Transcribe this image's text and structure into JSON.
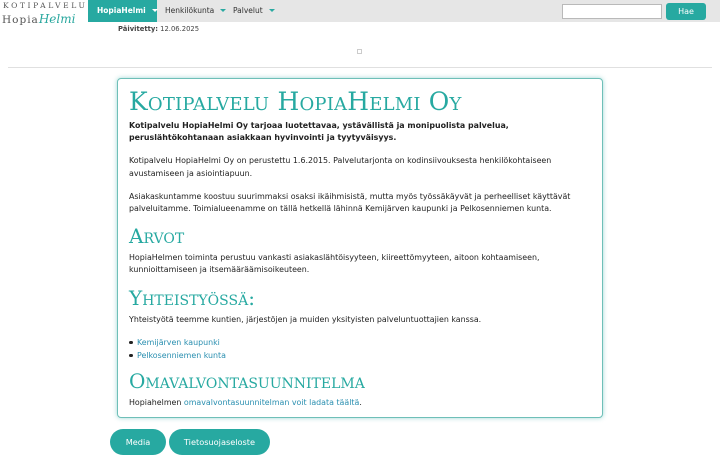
{
  "logo": {
    "top_text": "KOTIPALVELU",
    "hopia": "Hopia",
    "helmi": "Helmi"
  },
  "nav": {
    "items": [
      {
        "label": "HopiaHelmi",
        "active": true
      },
      {
        "label": "Henkilökunta",
        "active": false
      },
      {
        "label": "Palvelut",
        "active": false
      }
    ]
  },
  "search": {
    "value": "",
    "placeholder": "",
    "button_label": "Hae"
  },
  "updated": {
    "label": "Päivitetty:",
    "date": "12.06.2025"
  },
  "content": {
    "title": "Kotipalvelu HopiaHelmi Oy",
    "lead": "Kotipalvelu HopiaHelmi Oy tarjoaa luotettavaa, ystävällistä ja monipuolista palvelua, peruslähtökohtanaan asiakkaan hyvinvointi ja tyytyväisyys.",
    "p1": "Kotipalvelu HopiaHelmi Oy on perustettu 1.6.2015. Palvelutarjonta on kodinsiivouksesta henkilökohtaiseen avustamiseen ja asiointiapuun.",
    "p2": "Asiakaskuntamme koostuu suurimmaksi osaksi ikäihmisistä, mutta myös työssäkäyvät ja perheelliset käyttävät palveluitamme. Toimialueenamme on tällä hetkellä lähinnä Kemijärven kaupunki ja Pelkosenniemen kunta.",
    "h_values": "Arvot",
    "values_text": "HopiaHelmen toiminta perustuu vankasti asiakaslähtöisyyteen, kiireettömyyteen, aitoon kohtaamiseen, kunnioittamiseen ja itsemääräämisoikeuteen.",
    "h_coop": "Yhteistyössä:",
    "coop_text": "Yhteistyötä teemme kuntien, järjestöjen ja muiden yksityisten palveluntuottajien kanssa.",
    "coop_links": [
      "Kemijärven kaupunki",
      "Pelkosenniemen kunta"
    ],
    "h_plan": "Omavalvontasuunnitelma",
    "plan_prefix": "Hopiahelmen ",
    "plan_link": "omavalvontasuunnitelman voit ladata täältä",
    "plan_suffix": "."
  },
  "footer_buttons": {
    "media": "Media",
    "privacy": "Tietosuojaseloste"
  },
  "colors": {
    "accent": "#27a9a1",
    "link": "#2a8fb0",
    "topbar": "#e6e6e6"
  }
}
